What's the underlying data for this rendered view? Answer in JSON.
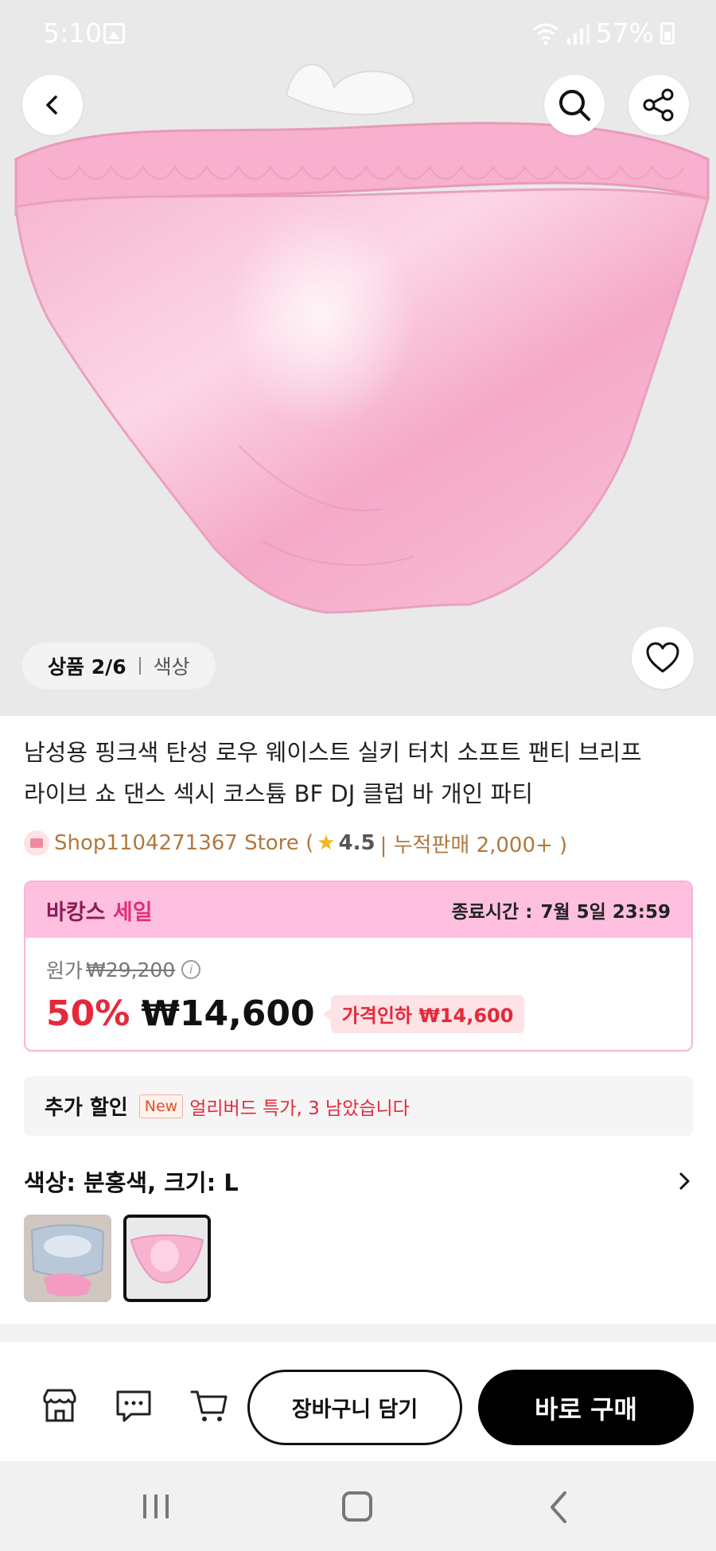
{
  "status_bar": {
    "time": "5:10",
    "battery": "57%"
  },
  "icons": {
    "back": "back-arrow-icon",
    "search": "search-icon",
    "share": "share-icon",
    "wishlist": "heart-icon",
    "store": "store-icon",
    "chat": "chat-icon",
    "cart": "cart-icon"
  },
  "gallery": {
    "counter": "상품 2/6",
    "label": "색상"
  },
  "product": {
    "title_line1": "남성용 핑크색 탄성 로우 웨이스트 실키 터치 소프트 팬티 브리프",
    "title_line2": "라이브 쇼 댄스 섹시 코스튬 BF DJ 클럽 바 개인 파티"
  },
  "store": {
    "name": "Shop1104271367 Store (",
    "rating": "4.5",
    "meta": "| 누적판매 2,000+ )"
  },
  "sale": {
    "title_part1": "바캉스 ",
    "title_part2": "세일",
    "end_label": "종료시간 :",
    "end_time": "7월 5일 23:59",
    "original_label": "원가",
    "original_price": "₩29,200",
    "discount": "50%",
    "final_price": "₩14,600",
    "price_drop": "가격인하 ₩14,600"
  },
  "extra_discount": {
    "label": "추가 할인",
    "badge": "New",
    "text": "얼리버드 특가, 3 남았습니다"
  },
  "option": {
    "text": "색상: 분홍색, 크기: L"
  },
  "actions": {
    "add_to_cart": "장바구니 담기",
    "buy_now": "바로 구매"
  },
  "colors": {
    "accent_red": "#e5283b",
    "sale_pink": "#ffc0df",
    "buy_button": "#000000"
  }
}
